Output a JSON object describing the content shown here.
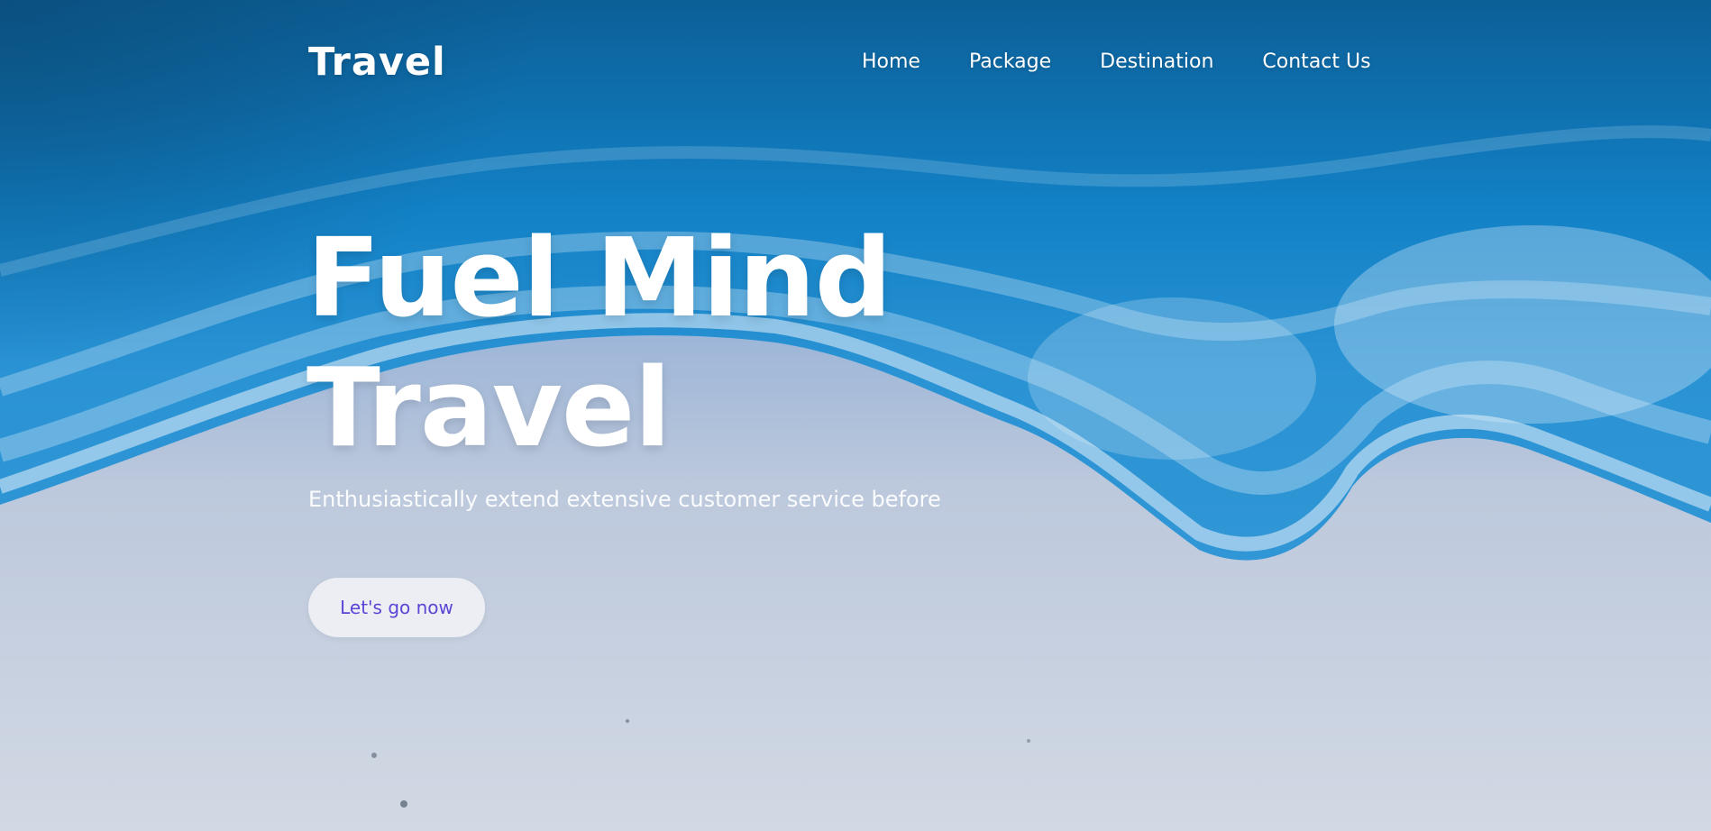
{
  "brand": {
    "logo_text": "Travel"
  },
  "nav": {
    "items": [
      {
        "label": "Home"
      },
      {
        "label": "Package"
      },
      {
        "label": "Destination"
      },
      {
        "label": "Contact Us"
      }
    ]
  },
  "hero": {
    "headline_line1": "Fuel Mind",
    "headline_line2": "Travel",
    "subtitle": "Enthusiastically extend extensive customer service before",
    "cta_label": "Let's go now"
  },
  "colors": {
    "cta_background": "#eceef4",
    "cta_text": "#5a45d4",
    "ocean": "#1386c9",
    "sand": "#cfd7e2"
  }
}
